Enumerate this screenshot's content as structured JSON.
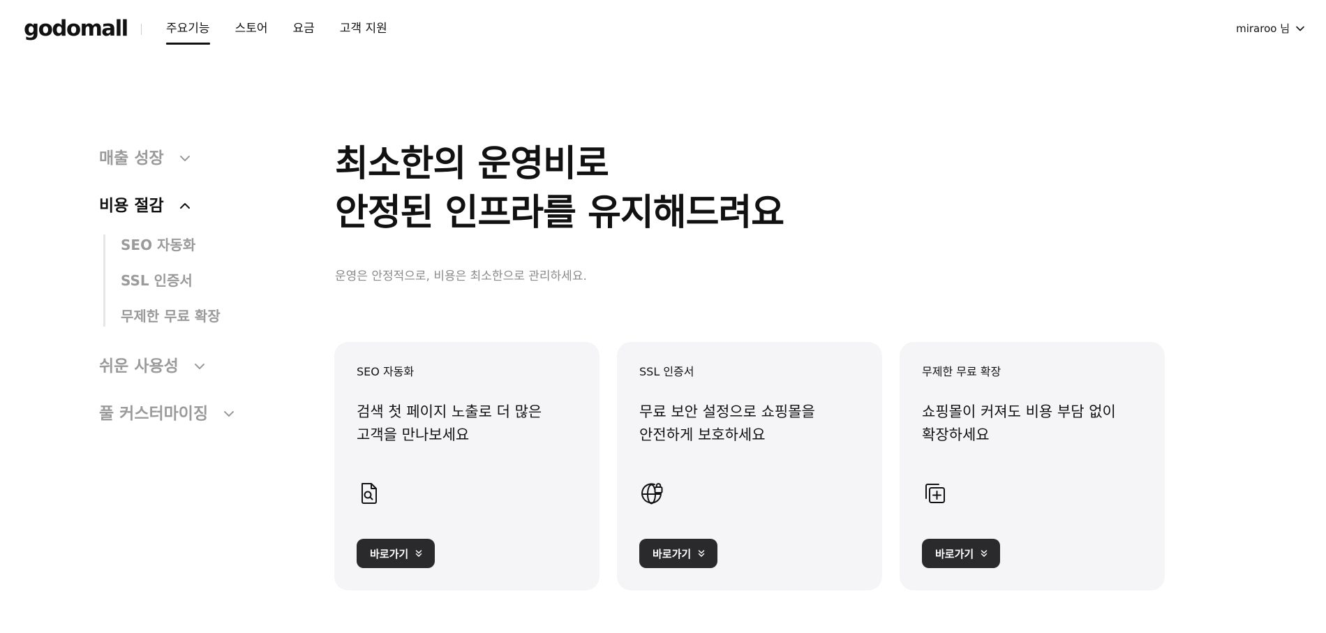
{
  "header": {
    "logo": "godomall",
    "nav": [
      {
        "label": "주요기능",
        "active": true
      },
      {
        "label": "스토어"
      },
      {
        "label": "요금"
      },
      {
        "label": "고객 지원"
      }
    ],
    "user_label": "miraroo 님"
  },
  "sidebar": {
    "groups": [
      {
        "label": "매출 성장",
        "expanded": false
      },
      {
        "label": "비용 절감",
        "expanded": true,
        "items": [
          "SEO 자동화",
          "SSL 인증서",
          "무제한 무료 확장"
        ]
      },
      {
        "label": "쉬운 사용성",
        "expanded": false
      },
      {
        "label": "풀 커스터마이징",
        "expanded": false
      }
    ]
  },
  "hero": {
    "title_line1": "최소한의 운영비로",
    "title_line2": "안정된 인프라를 유지해드려요",
    "subtitle": "운영은 안정적으로, 비용은 최소한으로 관리하세요."
  },
  "cards": [
    {
      "kicker": "SEO 자동화",
      "desc_line1": "검색 첫 페이지 노출로 더 많은",
      "desc_line2": "고객을 만나보세요",
      "icon": "document-search-icon",
      "button": "바로가기"
    },
    {
      "kicker": "SSL 인증서",
      "desc_line1": "무료 보안 설정으로 쇼핑몰을",
      "desc_line2": "안전하게 보호하세요",
      "icon": "globe-lock-icon",
      "button": "바로가기"
    },
    {
      "kicker": "무제한 무료 확장",
      "desc_line1": "쇼핑몰이 커져도 비용 부담 없이",
      "desc_line2": "확장하세요",
      "icon": "copy-plus-icon",
      "button": "바로가기"
    }
  ],
  "colors": {
    "text": "#111111",
    "muted": "#9a9a9a",
    "card_bg": "#f5f5f7",
    "button_bg": "#2a2a2d"
  }
}
